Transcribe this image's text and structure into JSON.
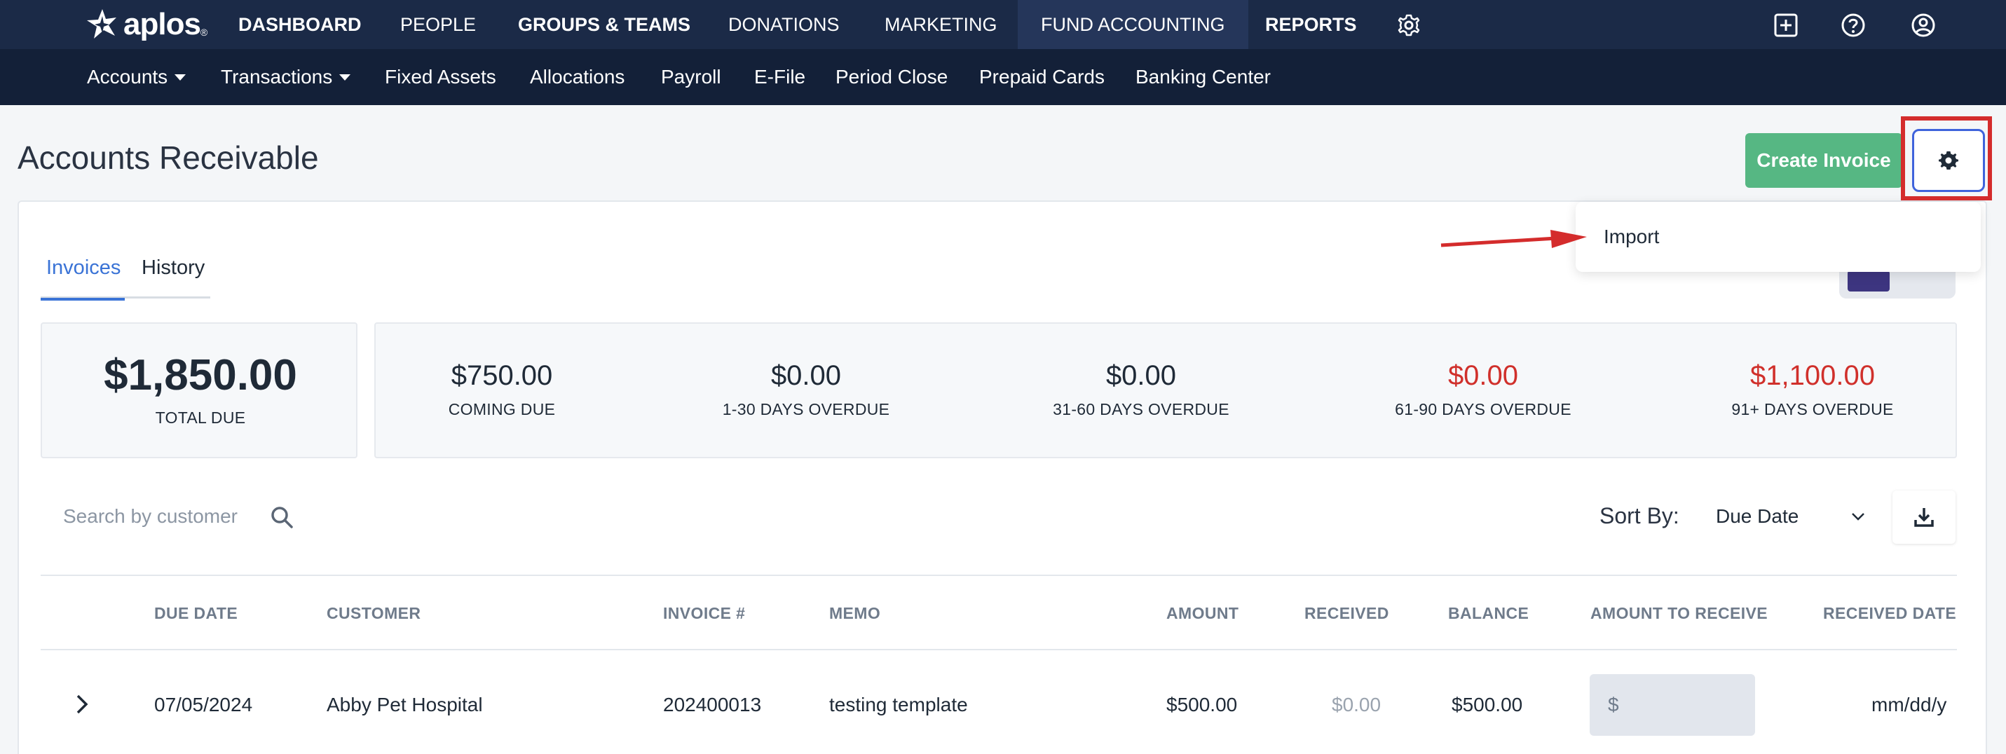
{
  "brand": {
    "name": "aplos",
    "reg": "®"
  },
  "topnav": {
    "items": [
      {
        "label": "DASHBOARD"
      },
      {
        "label": "PEOPLE"
      },
      {
        "label": "GROUPS & TEAMS"
      },
      {
        "label": "DONATIONS"
      },
      {
        "label": "MARKETING"
      },
      {
        "label": "FUND ACCOUNTING"
      },
      {
        "label": "REPORTS"
      }
    ],
    "icons": [
      "gear-icon",
      "add-square-icon",
      "help-circle-icon",
      "user-circle-icon"
    ]
  },
  "subnav": {
    "items": [
      {
        "label": "Accounts"
      },
      {
        "label": "Transactions"
      },
      {
        "label": "Fixed Assets"
      },
      {
        "label": "Allocations"
      },
      {
        "label": "Payroll"
      },
      {
        "label": "E-File"
      },
      {
        "label": "Period Close"
      },
      {
        "label": "Prepaid Cards"
      },
      {
        "label": "Banking Center"
      }
    ]
  },
  "page": {
    "title": "Accounts Receivable",
    "create_label": "Create Invoice"
  },
  "dropdown": {
    "items": [
      {
        "label": "Import"
      }
    ]
  },
  "tabs": [
    {
      "label": "Invoices"
    },
    {
      "label": "History"
    }
  ],
  "summary": {
    "total": {
      "value": "$1,850.00",
      "label": "TOTAL DUE"
    },
    "buckets": [
      {
        "value": "$750.00",
        "label": "COMING DUE"
      },
      {
        "value": "$0.00",
        "label": "1-30 DAYS OVERDUE"
      },
      {
        "value": "$0.00",
        "label": "31-60 DAYS OVERDUE"
      },
      {
        "value": "$0.00",
        "label": "61-90 DAYS OVERDUE"
      },
      {
        "value": "$1,100.00",
        "label": "91+ DAYS OVERDUE"
      }
    ]
  },
  "search": {
    "placeholder": "Search by customer"
  },
  "sort": {
    "label": "Sort By:",
    "value": "Due Date"
  },
  "table": {
    "columns": [
      "DUE DATE",
      "CUSTOMER",
      "INVOICE #",
      "MEMO",
      "AMOUNT",
      "RECEIVED",
      "BALANCE",
      "AMOUNT TO RECEIVE",
      "RECEIVED DATE"
    ],
    "rows": [
      {
        "due_date": "07/05/2024",
        "customer": "Abby Pet Hospital",
        "invoice": "202400013",
        "memo": "testing template",
        "amount": "$500.00",
        "received": "$0.00",
        "balance": "$500.00",
        "amount_to_receive": "$",
        "received_date": "mm/dd/y"
      }
    ]
  },
  "colors": {
    "nav": "#1b2a47",
    "subnav": "#132038",
    "accent": "#3a73d6",
    "create": "#56b783",
    "overdue": "#d0302b",
    "annotation": "#d42c2c"
  }
}
